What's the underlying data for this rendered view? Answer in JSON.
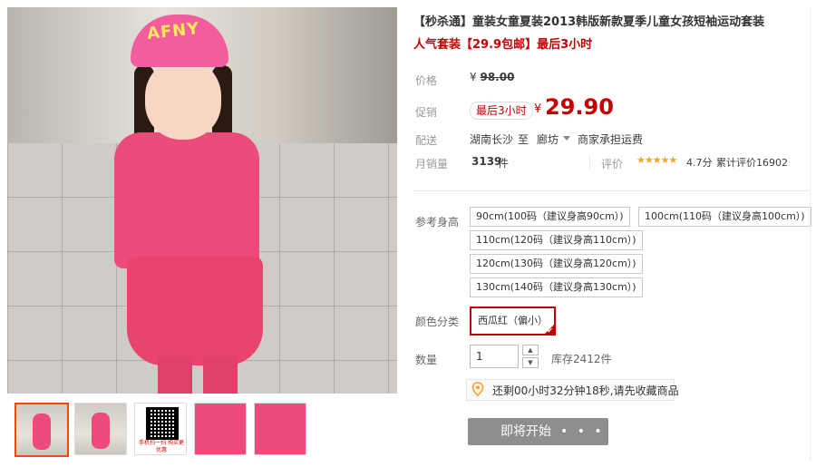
{
  "product": {
    "title": "【秒杀通】童装女童夏装2013韩版新款夏季儿童女孩短袖运动套装",
    "subtitle": "人气套装【29.9包邮】最后3小时",
    "hat_text": "AFNY"
  },
  "price": {
    "label": "价格",
    "currency": "¥",
    "original": "98.00"
  },
  "promo": {
    "label": "促销",
    "badge": "最后3小时",
    "currency": "¥",
    "price": "29.90"
  },
  "shipping": {
    "label": "配送",
    "from": "湖南长沙",
    "to_word": "至",
    "destination": "廊坊",
    "fee": "商家承担运费"
  },
  "sales": {
    "label": "月销量",
    "count": "3139",
    "unit": "件",
    "rating_label": "评价",
    "stars": "★★★★★",
    "score": "4.7分",
    "reviews": "累计评价16902"
  },
  "sizes": {
    "label": "参考身高",
    "options": [
      "90cm(100码（建议身高90cm）)",
      "100cm(110码（建议身高100cm）)",
      "110cm(120码（建议身高110cm）)",
      "120cm(130码（建议身高120cm）)",
      "130cm(140码（建议身高130cm）)"
    ]
  },
  "colors": {
    "label": "颜色分类",
    "selected": "西瓜红（偏小）"
  },
  "quantity": {
    "label": "数量",
    "value": "1",
    "stock": "库存2412件"
  },
  "timer": {
    "text": "还剩00小时32分钟18秒,请先收藏商品"
  },
  "buy": {
    "label": "即将开始",
    "dots": "• • •"
  },
  "thumbnails": {
    "qr_text": "手机扫一扫 购买更优惠"
  },
  "colors_theme": {
    "accent": "#c40000",
    "pink": "#ec4b7b",
    "button_gray": "#8e8e8e",
    "star": "#f5a623"
  }
}
